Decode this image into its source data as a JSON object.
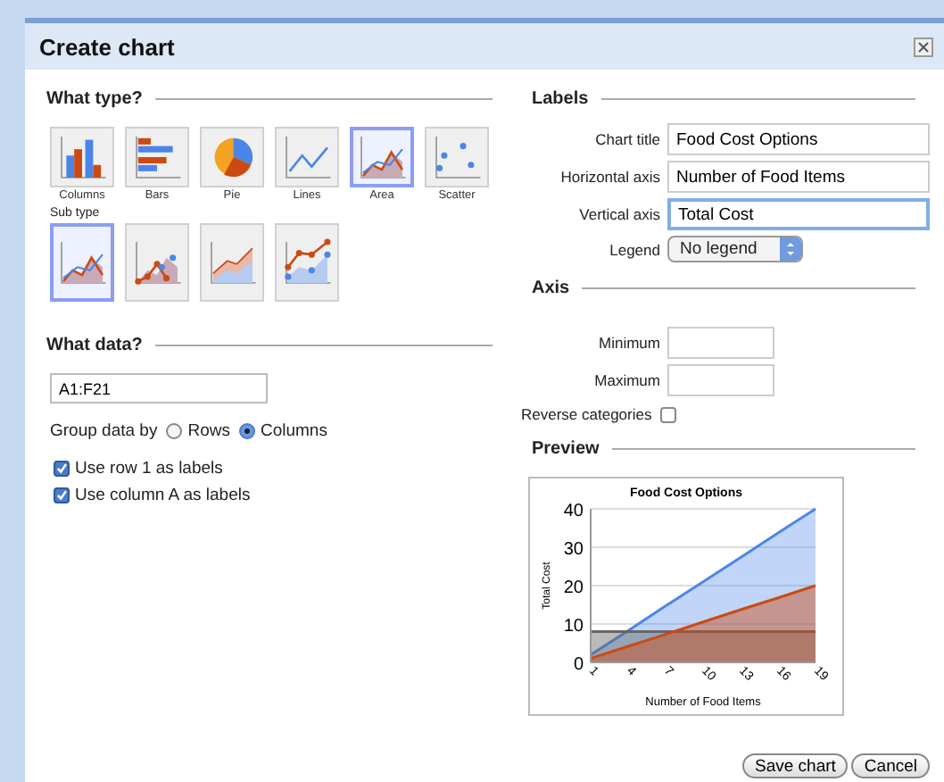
{
  "dialog": {
    "title": "Create chart"
  },
  "what_type": {
    "heading": "What type?",
    "chart_types": [
      {
        "label": "Columns",
        "kind": "columns",
        "selected": false
      },
      {
        "label": "Bars",
        "kind": "bars",
        "selected": false
      },
      {
        "label": "Pie",
        "kind": "pie",
        "selected": false
      },
      {
        "label": "Lines",
        "kind": "lines",
        "selected": false
      },
      {
        "label": "Area",
        "kind": "area",
        "selected": true
      },
      {
        "label": "Scatter",
        "kind": "scatter",
        "selected": false
      }
    ],
    "subtype_label": "Sub type",
    "subtypes": [
      {
        "kind": "area",
        "selected": true
      },
      {
        "kind": "area-points",
        "selected": false
      },
      {
        "kind": "stacked",
        "selected": false
      },
      {
        "kind": "stacked-points",
        "selected": false
      }
    ]
  },
  "what_data": {
    "heading": "What data?",
    "range": "A1:F21",
    "group_label": "Group data by",
    "group_options": [
      {
        "label": "Rows",
        "selected": false
      },
      {
        "label": "Columns",
        "selected": true
      }
    ],
    "checkboxes": [
      {
        "label": "Use row 1 as labels",
        "checked": true
      },
      {
        "label": "Use column A as labels",
        "checked": true
      }
    ]
  },
  "labels": {
    "heading": "Labels",
    "fields": [
      {
        "label": "Chart title",
        "value": "Food Cost Options",
        "focused": false
      },
      {
        "label": "Horizontal axis",
        "value": "Number of Food Items",
        "focused": false
      },
      {
        "label": "Vertical axis",
        "value": "Total Cost",
        "focused": true
      }
    ],
    "legend": {
      "label": "Legend",
      "value": "No legend"
    }
  },
  "axis": {
    "heading": "Axis",
    "fields": [
      {
        "label": "Minimum"
      },
      {
        "label": "Maximum"
      }
    ],
    "reverse": {
      "label": "Reverse categories",
      "checked": false
    }
  },
  "preview": {
    "heading": "Preview",
    "chart_data": {
      "type": "area",
      "title": "Food Cost Options",
      "xlabel": "Number of Food Items",
      "ylabel": "Total Cost",
      "categories": [
        "1",
        "4",
        "7",
        "10",
        "13",
        "16",
        "19"
      ],
      "series": [
        {
          "color": "#4a86e8",
          "values": [
            2,
            8.3,
            14.7,
            21,
            27.3,
            33.7,
            40
          ]
        },
        {
          "color": "#666666",
          "values": [
            8,
            8,
            8,
            8,
            8,
            8,
            8
          ]
        },
        {
          "color": "#cc4a12",
          "values": [
            1,
            4.2,
            7.3,
            10.5,
            13.7,
            16.8,
            20
          ]
        }
      ],
      "yticks": [
        0,
        10,
        20,
        30,
        40
      ],
      "ylim": [
        0,
        40
      ],
      "grid": true
    }
  },
  "buttons": [
    {
      "label": "Save chart"
    },
    {
      "label": "Cancel"
    }
  ]
}
